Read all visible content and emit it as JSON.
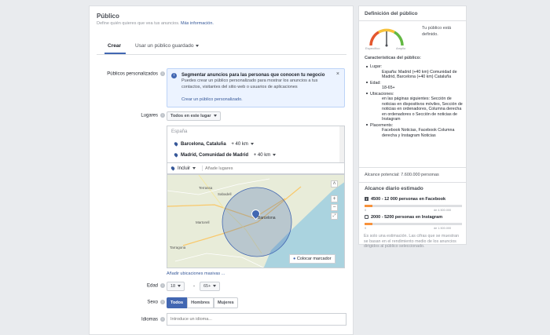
{
  "main": {
    "title": "Público",
    "subtitle": "Define quién quieres que vea tus anuncios.",
    "subtitle_link": "Más información.",
    "tabs": [
      "Crear",
      "Usar un público guardado"
    ],
    "custom_audiences": {
      "label": "Públicos personalizados",
      "box_title": "Segmentar anuncios para las personas que conocen tu negocio",
      "box_text": "Puedes crear un público personalizado para mostrar los anuncios a tus contactos, visitantes del sitio web o usuarios de aplicaciones",
      "box_link": "Crear un público personalizado."
    },
    "locations": {
      "label": "Lugares",
      "dropdown": "Todos en este lugar",
      "country": "España",
      "items": [
        {
          "name": "Barcelona, Cataluña",
          "radius": "+ 40 km"
        },
        {
          "name": "Madrid, Comunidad de Madrid",
          "radius": "+ 40 km"
        }
      ],
      "include": "Incluir",
      "add_placeholder": "Añade lugares",
      "pin_button": "Colocar marcador",
      "bulk_link": "Añadir ubicaciones masivas ...",
      "map_labels": [
        "Barcelona",
        "Sabadell",
        "Terrassa",
        "Tarragona",
        "Martorell"
      ]
    },
    "age": {
      "label": "Edad",
      "from": "18",
      "to": "65+",
      "separator": "-"
    },
    "gender": {
      "label": "Sexo",
      "options": [
        "Todos",
        "Hombres",
        "Mujeres"
      ],
      "selected": "Todos"
    },
    "languages": {
      "label": "Idiomas",
      "placeholder": "Introduce un idioma..."
    }
  },
  "side": {
    "title": "Definición del público",
    "gauge_text": "Tu público está definido.",
    "gauge_left": "Específico",
    "gauge_right": "Amplio",
    "gauge_level": 0.5,
    "features_title": "Características del público:",
    "place_label": "Lugar:",
    "place_value": "España: Madrid (+40 km) Comunidad de Madrid, Barcelona (+40 km) Cataluña",
    "age_label": "Edad:",
    "age_value": "18-65+",
    "placements_label": "Ubicaciones:",
    "placements_value": "en las páginas siguientes: Sección de noticias en dispositivos móviles, Sección de noticias en ordenadores, Columna derecha en ordenadores o Sección de noticias de Instagram",
    "locations_label": "Placements:",
    "locations_value": "Facebook Noticias, Facebook Columna derecha y Instagram Noticias",
    "reach": "Alcance potencial: 7.600.000 personas",
    "daily_title": "Alcance diario estimado",
    "facebook": {
      "text": "4500 - 12 000 personas en Facebook",
      "min": "0",
      "max": "de 4.500.000",
      "fill": 0.08
    },
    "instagram": {
      "text": "2000 - 5200 personas en Instagram",
      "min": "0",
      "max": "de 1.500.000",
      "fill": 0.08
    },
    "note": "Es solo una estimación. Las cifras que se muestran se basan en el rendimiento medio de los anuncios dirigidos al público seleccionado."
  },
  "colors": {
    "accent": "#4267b2",
    "link": "#365899",
    "orange": "#f7923b"
  }
}
